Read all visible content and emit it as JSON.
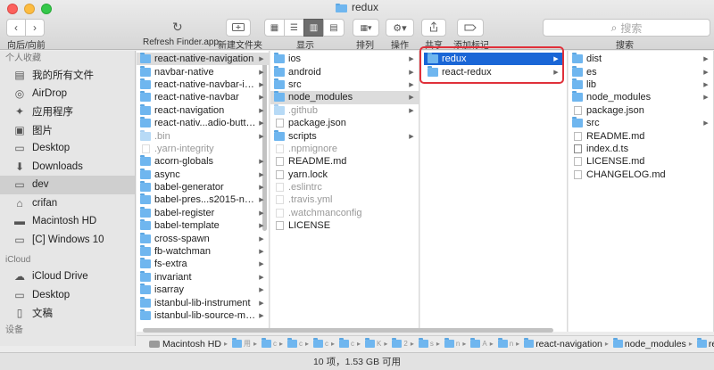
{
  "window": {
    "title": "redux"
  },
  "toolbar": {
    "nav_label": "向后/向前",
    "refresh_label": "Refresh Finder.app",
    "new_folder_label": "新建文件夹",
    "view_label": "显示",
    "arrange_label": "排列",
    "action_label": "操作",
    "share_label": "共享",
    "tags_label": "添加标记",
    "search_label": "搜索",
    "search_placeholder": "搜索"
  },
  "sidebar": {
    "sections": [
      {
        "title": "个人收藏",
        "items": [
          {
            "label": "我的所有文件",
            "icon": "all-files-icon"
          },
          {
            "label": "AirDrop",
            "icon": "airdrop-icon"
          },
          {
            "label": "应用程序",
            "icon": "applications-icon"
          },
          {
            "label": "图片",
            "icon": "pictures-icon"
          },
          {
            "label": "Desktop",
            "icon": "folder-icon"
          },
          {
            "label": "Downloads",
            "icon": "downloads-icon"
          },
          {
            "label": "dev",
            "icon": "folder-icon",
            "selected": true
          },
          {
            "label": "crifan",
            "icon": "home-icon"
          },
          {
            "label": "Macintosh HD",
            "icon": "hard-drive-icon"
          },
          {
            "label": "[C] Windows 10",
            "icon": "display-icon"
          }
        ]
      },
      {
        "title": "iCloud",
        "items": [
          {
            "label": "iCloud Drive",
            "icon": "cloud-icon"
          },
          {
            "label": "Desktop",
            "icon": "folder-icon"
          },
          {
            "label": "文稿",
            "icon": "documents-icon"
          }
        ]
      },
      {
        "title": "设备",
        "items": []
      }
    ]
  },
  "columns": {
    "col1": [
      {
        "name": "react-native-navigation",
        "type": "folder",
        "arrow": true,
        "sel": "grey"
      },
      {
        "name": "navbar-native",
        "type": "folder",
        "arrow": true
      },
      {
        "name": "react-native-navbar-icon",
        "type": "folder",
        "arrow": true
      },
      {
        "name": "react-native-navbar",
        "type": "folder",
        "arrow": true
      },
      {
        "name": "react-navigation",
        "type": "folder",
        "arrow": true
      },
      {
        "name": "react-nativ...adio-buttons",
        "type": "folder",
        "arrow": true
      },
      {
        "name": ".bin",
        "type": "folder",
        "arrow": true,
        "dim": true
      },
      {
        "name": ".yarn-integrity",
        "type": "file",
        "dim": true
      },
      {
        "name": "acorn-globals",
        "type": "folder",
        "arrow": true
      },
      {
        "name": "async",
        "type": "folder",
        "arrow": true
      },
      {
        "name": "babel-generator",
        "type": "folder",
        "arrow": true
      },
      {
        "name": "babel-pres...s2015-node",
        "type": "folder",
        "arrow": true
      },
      {
        "name": "babel-register",
        "type": "folder",
        "arrow": true
      },
      {
        "name": "babel-template",
        "type": "folder",
        "arrow": true
      },
      {
        "name": "cross-spawn",
        "type": "folder",
        "arrow": true
      },
      {
        "name": "fb-watchman",
        "type": "folder",
        "arrow": true
      },
      {
        "name": "fs-extra",
        "type": "folder",
        "arrow": true
      },
      {
        "name": "invariant",
        "type": "folder",
        "arrow": true
      },
      {
        "name": "isarray",
        "type": "folder",
        "arrow": true
      },
      {
        "name": "istanbul-lib-instrument",
        "type": "folder",
        "arrow": true
      },
      {
        "name": "istanbul-lib-source-maps",
        "type": "folder",
        "arrow": true
      }
    ],
    "col2": [
      {
        "name": "ios",
        "type": "folder",
        "arrow": true
      },
      {
        "name": "android",
        "type": "folder",
        "arrow": true
      },
      {
        "name": "src",
        "type": "folder",
        "arrow": true
      },
      {
        "name": "node_modules",
        "type": "folder",
        "arrow": true,
        "sel": "grey"
      },
      {
        "name": ".github",
        "type": "folder",
        "arrow": true,
        "dim": true
      },
      {
        "name": "package.json",
        "type": "file"
      },
      {
        "name": "scripts",
        "type": "folder",
        "arrow": true
      },
      {
        "name": ".npmignore",
        "type": "file",
        "dim": true
      },
      {
        "name": "README.md",
        "type": "file"
      },
      {
        "name": "yarn.lock",
        "type": "file"
      },
      {
        "name": ".eslintrc",
        "type": "file",
        "dim": true
      },
      {
        "name": ".travis.yml",
        "type": "file",
        "dim": true
      },
      {
        "name": ".watchmanconfig",
        "type": "file",
        "dim": true
      },
      {
        "name": "LICENSE",
        "type": "file"
      }
    ],
    "col3": [
      {
        "name": "redux",
        "type": "folder",
        "arrow": true,
        "sel": "blue"
      },
      {
        "name": "react-redux",
        "type": "folder",
        "arrow": true
      }
    ],
    "col4": [
      {
        "name": "dist",
        "type": "folder",
        "arrow": true
      },
      {
        "name": "es",
        "type": "folder",
        "arrow": true
      },
      {
        "name": "lib",
        "type": "folder",
        "arrow": true
      },
      {
        "name": "node_modules",
        "type": "folder",
        "arrow": true
      },
      {
        "name": "package.json",
        "type": "file"
      },
      {
        "name": "src",
        "type": "folder",
        "arrow": true
      },
      {
        "name": "README.md",
        "type": "file"
      },
      {
        "name": "index.d.ts",
        "type": "file-ts"
      },
      {
        "name": "LICENSE.md",
        "type": "file"
      },
      {
        "name": "CHANGELOG.md",
        "type": "file"
      }
    ]
  },
  "pathbar": {
    "root": "Macintosh HD",
    "truncated": [
      "用",
      "c",
      "c",
      "c",
      "c",
      "K",
      "2",
      "s",
      "n",
      "A",
      "n"
    ],
    "tail": [
      "react-navigation",
      "node_modules",
      "redux"
    ]
  },
  "status": {
    "text": "10 项，1.53 GB 可用"
  },
  "colors": {
    "selection_blue": "#1a66d6",
    "folder_blue": "#6fb6ef",
    "highlight_red": "#e0303a"
  }
}
